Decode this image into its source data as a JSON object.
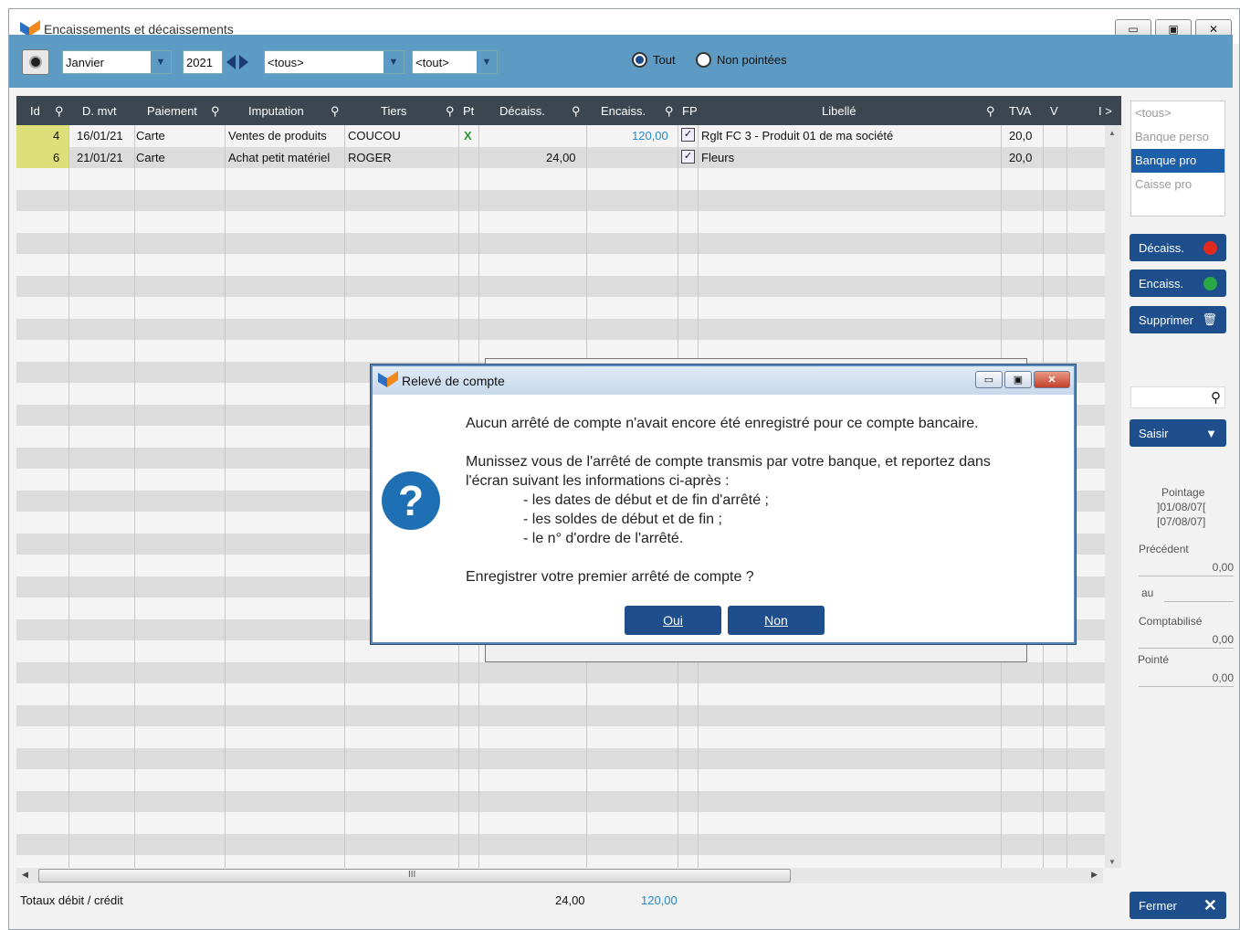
{
  "window": {
    "title": "Encaissements et décaissements"
  },
  "toolbar": {
    "month": "Janvier",
    "year": "2021",
    "tiers_filter": "<tous>",
    "filter2": "<tout>",
    "radio_all": "Tout",
    "radio_unpointed": "Non pointées"
  },
  "grid": {
    "headers": [
      "Id",
      "D. mvt",
      "Paiement",
      "Imputation",
      "Tiers",
      "Pt",
      "Décaiss.",
      "Encaiss.",
      "FP",
      "Libellé",
      "TVA",
      "V",
      "I >"
    ],
    "rows": [
      {
        "id": "4",
        "date": "16/01/21",
        "payment": "Carte",
        "imputation": "Ventes de produits",
        "tiers": "COUCOU",
        "pt": "X",
        "decaiss": "",
        "encaiss": "120,00",
        "label": "Rglt FC 3 - Produit 01 de ma société",
        "tva": "20,0"
      },
      {
        "id": "6",
        "date": "21/01/21",
        "payment": "Carte",
        "imputation": "Achat petit matériel",
        "tiers": "ROGER",
        "pt": "",
        "decaiss": "24,00",
        "encaiss": "",
        "label": "Fleurs",
        "tva": "20,0"
      }
    ],
    "hscroll_mark": "III"
  },
  "totals": {
    "label": "Totaux débit / crédit",
    "debit": "24,00",
    "credit": "120,00"
  },
  "sidebar": {
    "banks": [
      "<tous>",
      "Banque perso",
      "Banque pro",
      "Caisse pro"
    ],
    "selected_bank": "Banque pro",
    "btn_decaiss": "Décaiss.",
    "btn_encaiss": "Encaiss.",
    "btn_delete": "Supprimer",
    "btn_saisir": "Saisir",
    "pointage_label": "Pointage",
    "pointage_from": "]01/08/07[",
    "pointage_to": "[07/08/07]",
    "precedent_label": "Précédent",
    "precedent_value": "0,00",
    "au_label": "au",
    "comptabilise_label": "Comptabilisé",
    "comptabilise_value": "0,00",
    "pointe_label": "Pointé",
    "pointe_value": "0,00",
    "btn_close": "Fermer"
  },
  "dialog": {
    "title": "Relevé de compte",
    "line1": "Aucun arrêté de compte n'avait encore été enregistré pour ce compte bancaire.",
    "line2": "Munissez vous de l'arrêté de compte transmis par votre banque, et reportez dans",
    "line3": "l'écran suivant les informations ci-après :",
    "bullet1": "- les dates de début et de fin d'arrêté ;",
    "bullet2": "- les soldes de début et de fin ;",
    "bullet3": "- le n° d'ordre de l'arrêté.",
    "question": "Enregistrer votre premier arrêté de compte ?",
    "yes": "Oui",
    "no": "Non"
  },
  "colors": {
    "toolbar": "#5e9bc4",
    "header": "#3b4650",
    "accent": "#1e4f8c",
    "encaiss_text": "#2a8ad0",
    "id_bg": "#dde07a"
  }
}
